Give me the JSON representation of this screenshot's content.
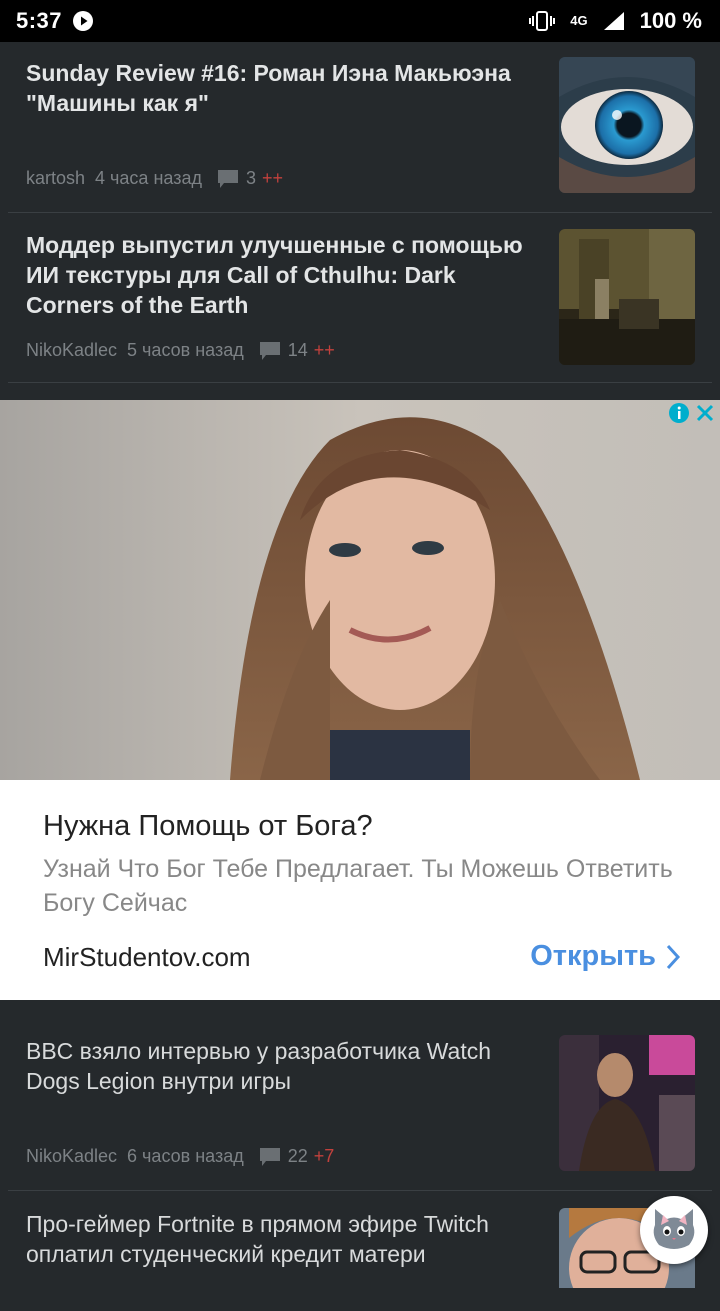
{
  "status_bar": {
    "time": "5:37",
    "network": "4G",
    "battery": "100 %"
  },
  "articles": [
    {
      "title": "Sunday Review #16: Роман Иэна Макьюэна \"Машины как я\"",
      "author": "kartosh",
      "time": "4 часа назад",
      "comments": "3",
      "delta": "++",
      "thumb_icon": "eye-thumbnail"
    },
    {
      "title": "Моддер выпустил улучшенные с помощью ИИ текстуры для Call of Cthulhu: Dark Corners of the Earth",
      "author": "NikoKadlec",
      "time": "5 часов назад",
      "comments": "14",
      "delta": "++",
      "thumb_icon": "game-room-thumbnail"
    },
    {
      "title": "BBC взяло интервью у разработчика Watch Dogs Legion внутри игры",
      "author": "NikoKadlec",
      "time": "6 часов назад",
      "comments": "22",
      "delta": "+7",
      "thumb_icon": "game-character-thumbnail"
    },
    {
      "title": "Про-геймер Fortnite в прямом эфире Twitch оплатил студенческий кредит матери",
      "thumb_icon": "streamer-thumbnail"
    }
  ],
  "ad": {
    "headline": "Нужна Помощь от Бога?",
    "body": "Узнай Что Бог Тебе Предлагает. Ты Можешь Ответить Богу Сейчас",
    "domain": "MirStudentov.com",
    "cta": "Открыть"
  },
  "colors": {
    "background": "#25292c",
    "accent_plus": "#c2413d",
    "cta_blue": "#4a8fe0"
  }
}
